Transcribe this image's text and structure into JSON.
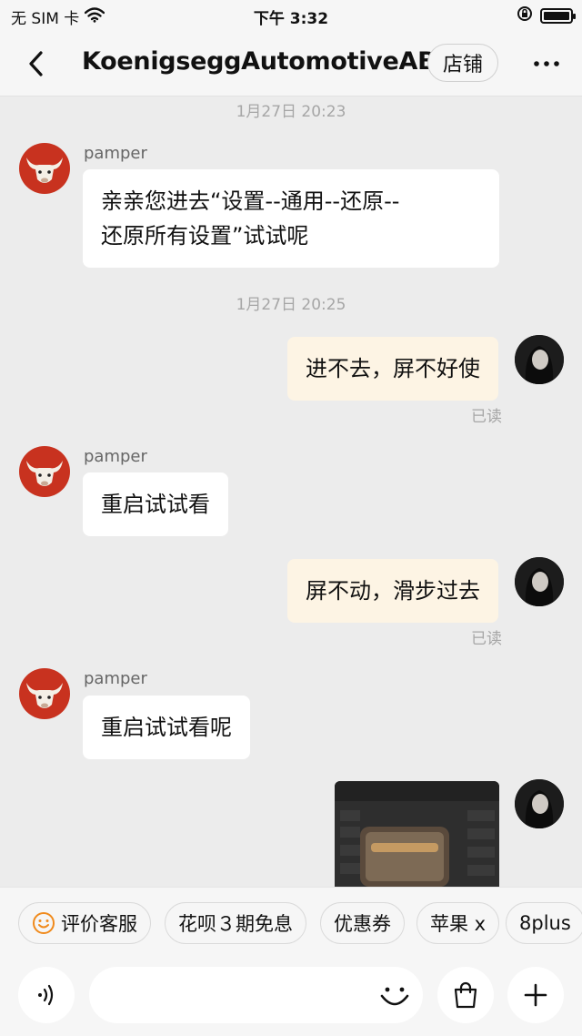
{
  "status_bar": {
    "carrier": "无 SIM 卡",
    "time": "下午 3:32"
  },
  "header": {
    "title": "KoenigseggAutomotiveAB",
    "shop_label": "店铺"
  },
  "messages": [
    {
      "timestamp": "1月27日 20:23"
    },
    {
      "sender": "pamper",
      "text_line1": "亲亲您进去“设置--通用--还原--",
      "text_line2": "还原所有设置”试试呢"
    },
    {
      "timestamp": "1月27日 20:25"
    },
    {
      "text": "进不去，屏不好使",
      "status": "已读"
    },
    {
      "sender": "pamper",
      "text": "重启试试看"
    },
    {
      "text": "屏不动，滑步过去",
      "status": "已读"
    },
    {
      "sender": "pamper",
      "text": "重启试试看呢"
    }
  ],
  "quick_replies": [
    {
      "label": "评价客服",
      "icon": "smile-icon"
    },
    {
      "label": "花呗３期免息"
    },
    {
      "label": "优惠券"
    },
    {
      "label": "苹果 x"
    },
    {
      "label": "8plus"
    }
  ],
  "input_bar": {
    "placeholder": ""
  },
  "colors": {
    "outgoing_bubble": "#fdf4e4",
    "incoming_bubble": "#ffffff",
    "background": "#ececec",
    "smile_icon": "#f08a1c"
  }
}
